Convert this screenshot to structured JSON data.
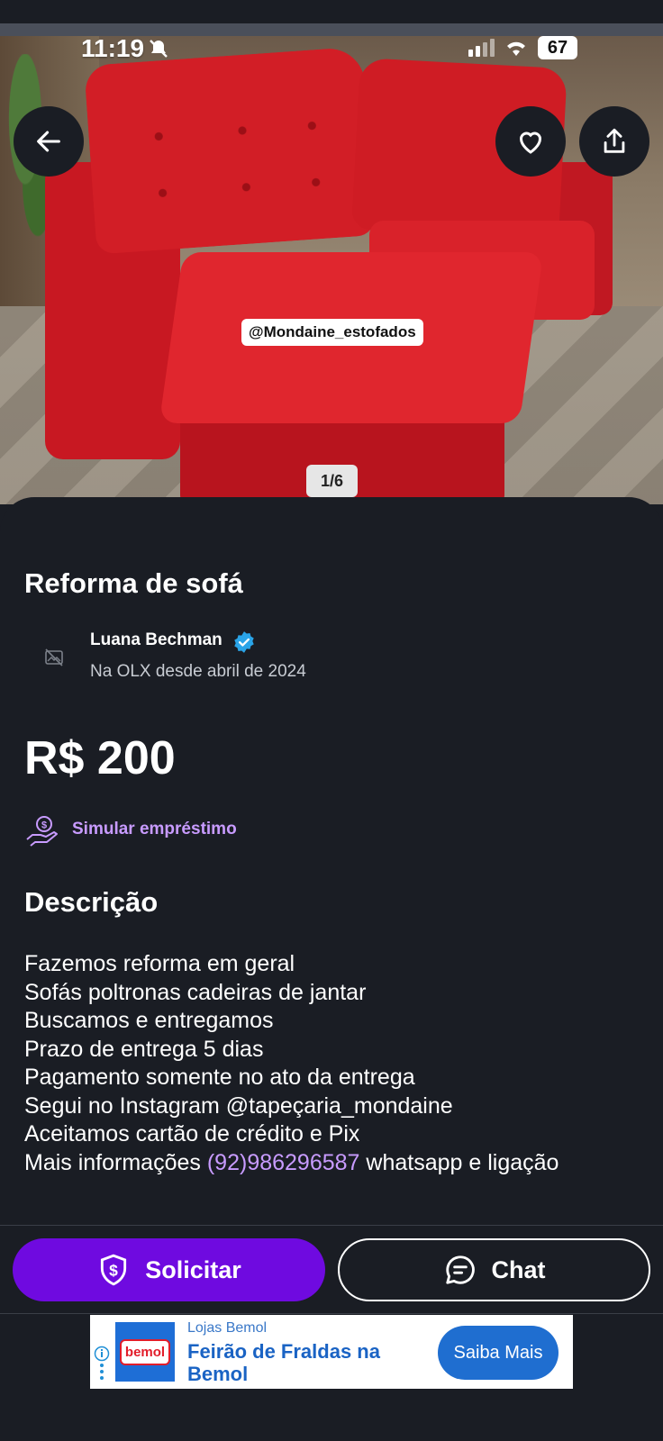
{
  "status_bar": {
    "time": "11:19",
    "battery": "67"
  },
  "listing": {
    "image_watermark": "@Mondaine_estofados",
    "image_counter": "1/6",
    "title": "Reforma de sofá",
    "price": "R$ 200"
  },
  "seller": {
    "name": "Luana Bechman",
    "since": "Na OLX desde abril de 2024"
  },
  "loan": {
    "label": "Simular empréstimo"
  },
  "description": {
    "heading": "Descrição",
    "lines": [
      "Fazemos reforma em geral",
      "Sofás poltronas cadeiras de jantar",
      "Buscamos e entregamos",
      "Prazo de entrega 5 dias",
      "Pagamento somente no ato da entrega",
      "Segui no Instagram @tapeçaria_mondaine",
      "Aceitamos cartão de crédito e Pix"
    ],
    "last_line_prefix": "Mais informações ",
    "phone": "(92)986296587",
    "last_line_suffix": " whatsapp e ligação"
  },
  "actions": {
    "solicitar": "Solicitar",
    "chat": "Chat"
  },
  "ad": {
    "logo_text": "bemol",
    "brand": "Lojas Bemol",
    "headline": "Feirão de Fraldas na Bemol",
    "cta": "Saiba Mais"
  },
  "colors": {
    "background": "#1a1d24",
    "accent_purple": "#6f0ae0",
    "link_purple": "#c89bff",
    "verified_blue": "#2aa4e8",
    "ad_blue": "#1f6ed0"
  }
}
